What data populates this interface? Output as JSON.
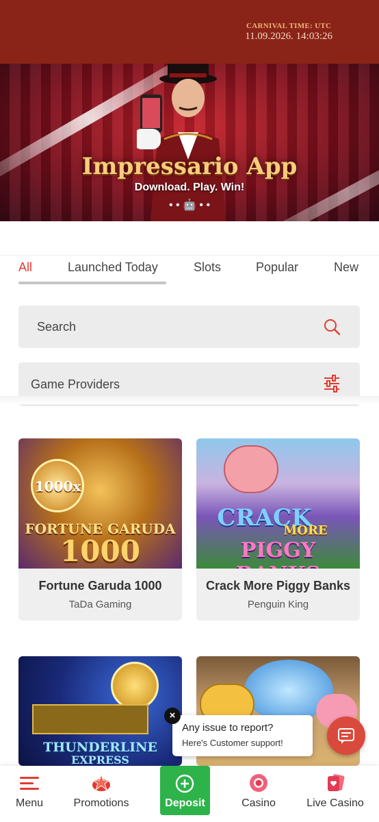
{
  "header": {
    "clock_label": "CARNIVAL TIME: UTC",
    "clock_time": "11.09.2026. 14:03:26",
    "background_color": "#8a2418"
  },
  "banner": {
    "title": "Impressario App",
    "subtitle": "Download. Play. Win!",
    "platforms": "• • 🤖 • •"
  },
  "tabs": [
    {
      "label": "All",
      "active": true
    },
    {
      "label": "Launched Today",
      "active": false
    },
    {
      "label": "Slots",
      "active": false
    },
    {
      "label": "Popular",
      "active": false
    },
    {
      "label": "New",
      "active": false
    }
  ],
  "search": {
    "placeholder": "Search",
    "icon": "search-icon"
  },
  "providers": {
    "label": "Game Providers",
    "icon": "filter-icon"
  },
  "games": [
    {
      "name": "Fortune Garuda 1000",
      "provider": "TaDa Gaming",
      "art_line1": "1000x",
      "art_line2": "FORTUNE GARUDA",
      "art_line3": "1000"
    },
    {
      "name": "Crack More Piggy Banks",
      "provider": "Penguin King",
      "art_line1": "CRACK",
      "art_line2": "MORE",
      "art_line3": "PIGGY BANKS"
    },
    {
      "name": "",
      "provider": "",
      "art_line1": "THUNDERLINE",
      "art_line2": "EXPRESS"
    },
    {
      "name": "",
      "provider": "",
      "art_line1": "",
      "art_line2": ""
    }
  ],
  "support_toast": {
    "title": "Any issue to report?",
    "subtitle": "Here's Customer support!",
    "close": "×"
  },
  "bottom_nav": [
    {
      "label": "Menu",
      "icon": "menu-icon"
    },
    {
      "label": "Promotions",
      "icon": "star-icon"
    },
    {
      "label": "Deposit",
      "icon": "plus-circle-icon"
    },
    {
      "label": "Casino",
      "icon": "chip-icon"
    },
    {
      "label": "Live Casino",
      "icon": "cards-icon"
    }
  ],
  "colors": {
    "accent": "#e23b30",
    "deposit": "#2db34a",
    "chat": "#d94a3c"
  }
}
